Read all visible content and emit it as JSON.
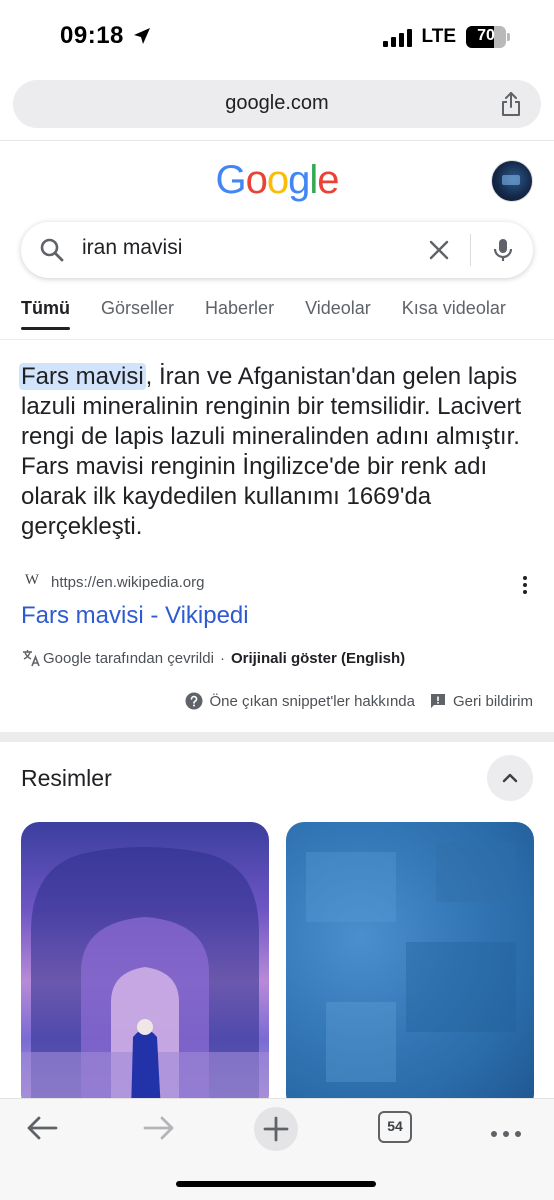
{
  "status_bar": {
    "time": "09:18",
    "network": "LTE",
    "battery": "70",
    "battery_level": 0.7
  },
  "browser": {
    "url": "google.com",
    "tab_count": "54"
  },
  "google": {
    "logo_letters": [
      {
        "char": "G",
        "color": "#4285F4"
      },
      {
        "char": "o",
        "color": "#EA4335"
      },
      {
        "char": "o",
        "color": "#FBBC05"
      },
      {
        "char": "g",
        "color": "#4285F4"
      },
      {
        "char": "l",
        "color": "#34A853"
      },
      {
        "char": "e",
        "color": "#EA4335"
      }
    ]
  },
  "search": {
    "query": "iran mavisi"
  },
  "tabs": [
    "Tümü",
    "Görseller",
    "Haberler",
    "Videolar",
    "Kısa videolar"
  ],
  "snippet": {
    "highlight": "Fars mavisi",
    "text": ", İran ve Afganistan'dan gelen lapis lazuli mineralinin renginin bir temsilidir. Lacivert rengi de lapis lazuli mineralinden adını almıştır. Fars mavisi renginin İngilizce'de bir renk adı olarak ilk kaydedilen kullanımı 1669'da gerçekleşti.",
    "source_icon": "W",
    "source_url": "https://en.wikipedia.org",
    "result_title": "Fars mavisi - Vikipedi",
    "translated_by": "Google tarafından çevrildi",
    "separator": "·",
    "show_original": "Orijinali göster (English)",
    "about_snippets": "Öne çıkan snippet'ler hakkında",
    "feedback": "Geri bildirim"
  },
  "images_section": {
    "title": "Resimler"
  }
}
